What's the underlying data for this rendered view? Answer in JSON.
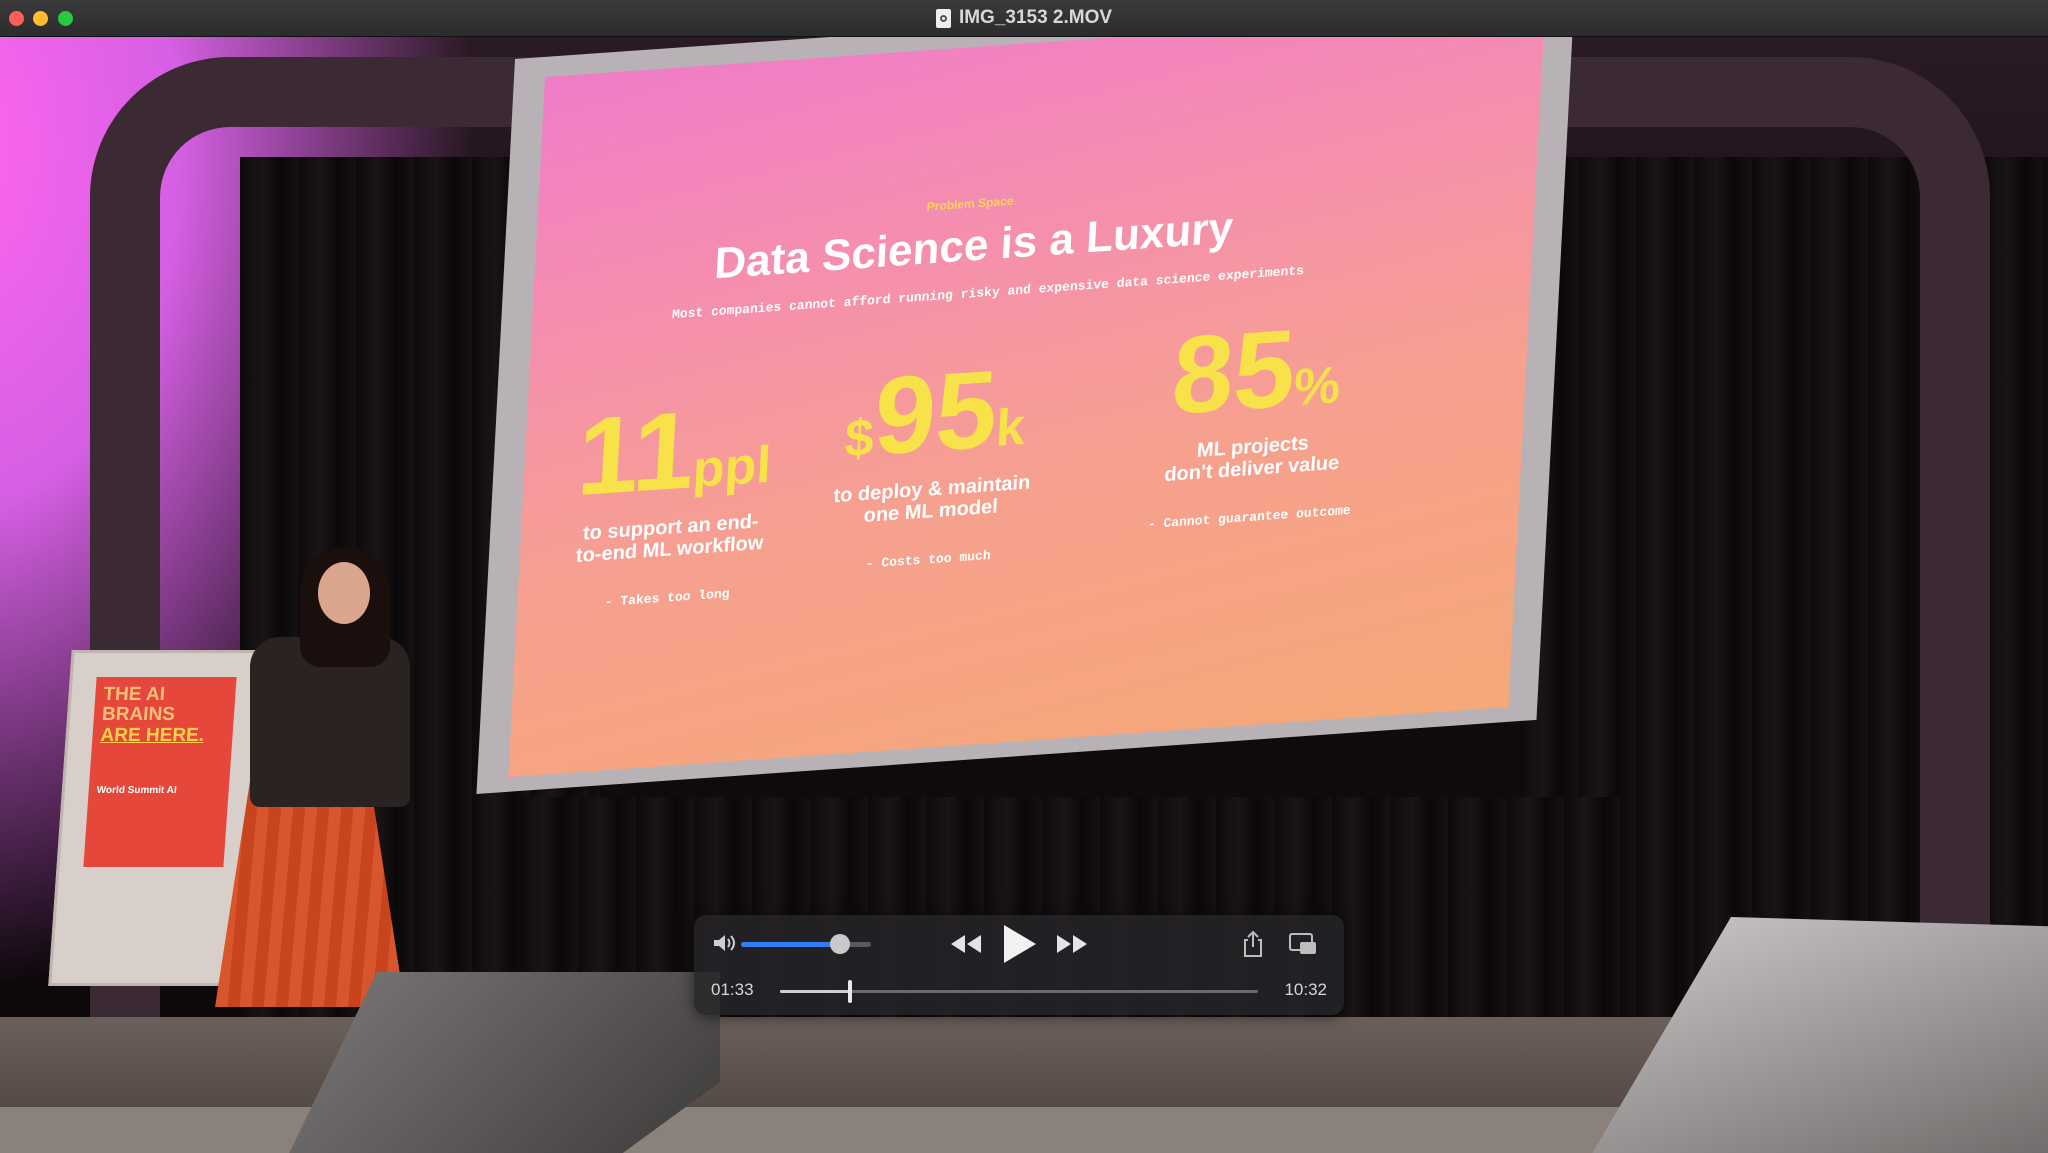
{
  "window": {
    "title": "IMG_3153 2.MOV",
    "file_icon": "document-icon"
  },
  "slide": {
    "eyebrow": "Problem Space",
    "title": "Data Science is a Luxury",
    "subtitle": "Most companies cannot afford running risky and expensive data science experiments",
    "stats": [
      {
        "number": "11",
        "unit_prefix": "",
        "unit": "ppl",
        "desc_line1": "to support an end-",
        "desc_line2": "to-end ML workflow",
        "note": "- Takes too long"
      },
      {
        "number": "95",
        "unit_prefix": "$",
        "unit": "k",
        "desc_line1": "to deploy & maintain",
        "desc_line2": "one ML model",
        "note": "- Costs too much"
      },
      {
        "number": "85",
        "unit_prefix": "",
        "unit": "%",
        "desc_line1": "ML projects",
        "desc_line2": "don't deliver value",
        "note": "- Cannot guarantee outcome"
      }
    ]
  },
  "lectern_poster": {
    "line1": "THE AI",
    "line2": "BRAINS",
    "line3": "ARE HERE.",
    "line4": "World Summit AI"
  },
  "player": {
    "current_time": "01:33",
    "duration": "10:32",
    "progress_fraction": 0.147,
    "volume_fraction": 0.76,
    "icons": {
      "volume": "speaker-volume-icon",
      "rewind": "rewind-icon",
      "play": "play-icon",
      "fast_forward": "fast-forward-icon",
      "share": "share-icon",
      "pip": "picture-in-picture-icon"
    },
    "accent_color": "#2f7ef6"
  }
}
